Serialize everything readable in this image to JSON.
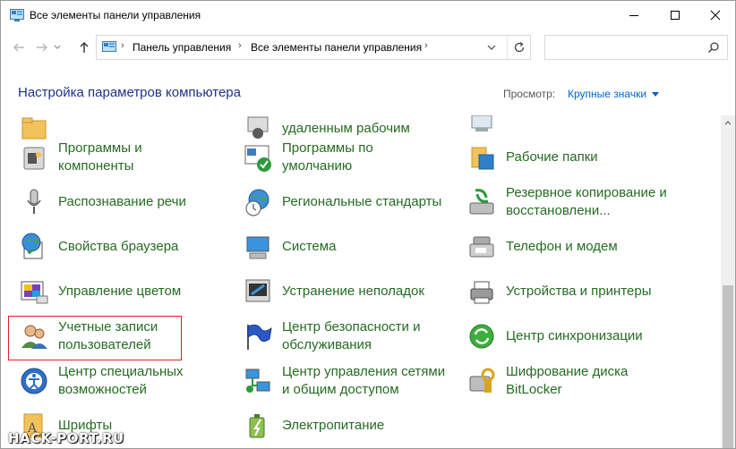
{
  "window": {
    "title": "Все элементы панели управления"
  },
  "address": {
    "crumbs": [
      "Панель управления",
      "Все элементы панели управления"
    ]
  },
  "search": {
    "placeholder": ""
  },
  "header": {
    "title": "Настройка параметров компьютера",
    "view_label": "Просмотр:",
    "view_value": "Крупные значки"
  },
  "items": [
    {
      "col": 0,
      "lines": [
        "",
        ""
      ],
      "icon": "folder-icon"
    },
    {
      "col": 1,
      "lines": [
        "удаленным рабочим"
      ],
      "icon": "remote-desktop-icon"
    },
    {
      "col": 2,
      "lines": [
        ""
      ],
      "icon": "network-icon"
    },
    {
      "lines": [
        "Программы и",
        "компоненты"
      ],
      "icon": "programs-icon"
    },
    {
      "lines": [
        "Программы по",
        "умолчанию"
      ],
      "icon": "default-programs-icon"
    },
    {
      "lines": [
        "Рабочие папки"
      ],
      "icon": "work-folders-icon"
    },
    {
      "lines": [
        "Распознавание речи"
      ],
      "icon": "microphone-icon"
    },
    {
      "lines": [
        "Региональные стандарты"
      ],
      "icon": "globe-clock-icon"
    },
    {
      "lines": [
        "Резервное копирование и",
        "восстановлени..."
      ],
      "icon": "backup-icon"
    },
    {
      "lines": [
        "Свойства браузера"
      ],
      "icon": "browser-options-icon"
    },
    {
      "lines": [
        "Система"
      ],
      "icon": "system-icon"
    },
    {
      "lines": [
        "Телефон и модем"
      ],
      "icon": "phone-modem-icon"
    },
    {
      "lines": [
        "Управление цветом"
      ],
      "icon": "color-management-icon"
    },
    {
      "lines": [
        "Устранение неполадок"
      ],
      "icon": "troubleshooting-icon"
    },
    {
      "lines": [
        "Устройства и принтеры"
      ],
      "icon": "printer-icon"
    },
    {
      "lines": [
        "Учетные записи",
        "пользователей"
      ],
      "icon": "user-accounts-icon"
    },
    {
      "lines": [
        "Центр безопасности и",
        "обслуживания"
      ],
      "icon": "flag-icon"
    },
    {
      "lines": [
        "Центр синхронизации"
      ],
      "icon": "sync-center-icon"
    },
    {
      "lines": [
        "Центр специальных",
        "возможностей"
      ],
      "icon": "accessibility-icon"
    },
    {
      "lines": [
        "Центр управления сетями",
        "и общим доступом"
      ],
      "icon": "network-center-icon"
    },
    {
      "lines": [
        "Шифрование диска",
        "BitLocker"
      ],
      "icon": "bitlocker-icon"
    },
    {
      "lines": [
        "Шрифты"
      ],
      "icon": "fonts-icon"
    },
    {
      "lines": [
        "Электропитание"
      ],
      "icon": "power-options-icon"
    }
  ],
  "watermark": "HACK-PORT.RU"
}
